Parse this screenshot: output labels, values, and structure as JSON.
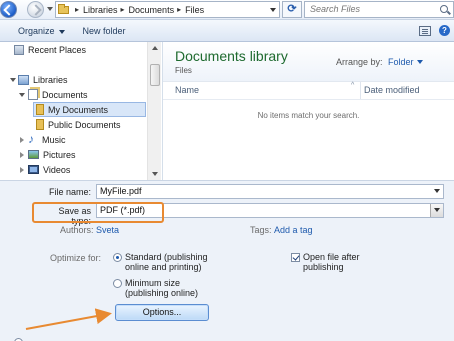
{
  "address": {
    "crumbs": [
      "Libraries",
      "Documents",
      "Files"
    ],
    "search_placeholder": "Search Files"
  },
  "toolbar": {
    "organize": "Organize",
    "new_folder": "New folder"
  },
  "nav": {
    "items": [
      {
        "label": "Recent Places",
        "icon": "recent-places-icon"
      },
      {
        "label": "Libraries",
        "icon": "libraries-icon"
      },
      {
        "label": "Documents",
        "icon": "documents-icon"
      },
      {
        "label": "My Documents",
        "icon": "folder-icon"
      },
      {
        "label": "Public Documents",
        "icon": "folder-icon"
      },
      {
        "label": "Music",
        "icon": "music-icon"
      },
      {
        "label": "Pictures",
        "icon": "pictures-icon"
      },
      {
        "label": "Videos",
        "icon": "videos-icon"
      }
    ]
  },
  "content": {
    "title": "Documents library",
    "subtitle": "Files",
    "arrange_label": "Arrange by:",
    "arrange_value": "Folder",
    "columns": [
      "Name",
      "Date modified"
    ],
    "empty_message": "No items match your search."
  },
  "form": {
    "file_name_label": "File name:",
    "file_name_value": "MyFile.pdf",
    "save_type_label": "Save as type:",
    "save_type_value": "PDF (*.pdf)",
    "authors_label": "Authors:",
    "authors_value": "Sveta",
    "tags_label": "Tags:",
    "tags_value": "Add a tag",
    "optimize_label": "Optimize for:",
    "opt_standard_line1": "Standard (publishing",
    "opt_standard_line2": "online and printing)",
    "opt_min_line1": "Minimum size",
    "opt_min_line2": "(publishing online)",
    "open_after_line1": "Open file after",
    "open_after_line2": "publishing",
    "options_button": "Options..."
  },
  "colors": {
    "highlight_box": "#e88a32",
    "library_title": "#1e6a2f",
    "link": "#1e5aad"
  }
}
